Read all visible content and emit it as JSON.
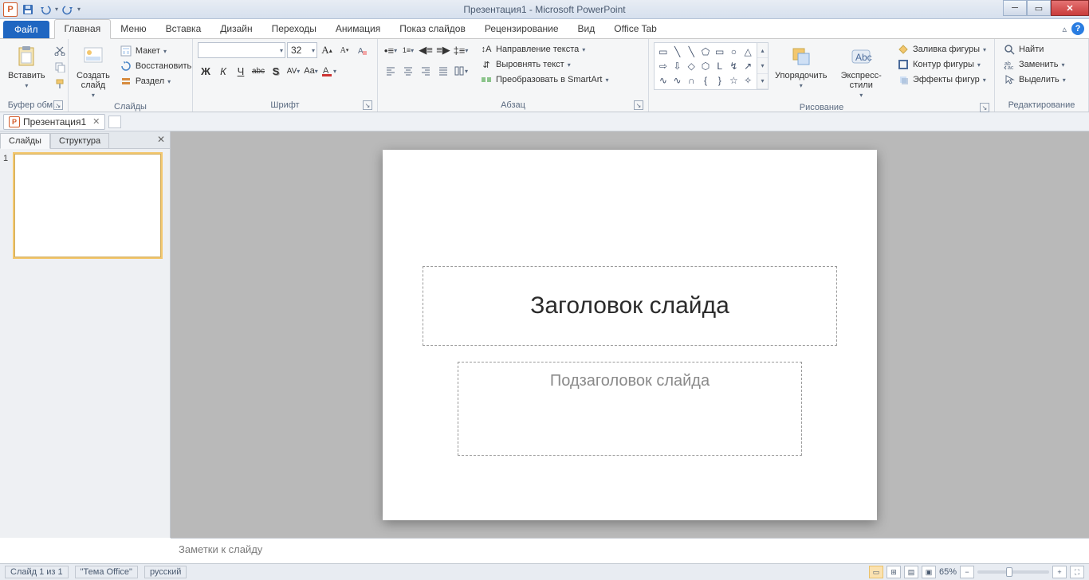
{
  "title": "Презентация1 - Microsoft PowerPoint",
  "qat": {
    "save": "save",
    "undo": "undo",
    "redo": "redo"
  },
  "tabs": {
    "file": "Файл",
    "items": [
      "Главная",
      "Меню",
      "Вставка",
      "Дизайн",
      "Переходы",
      "Анимация",
      "Показ слайдов",
      "Рецензирование",
      "Вид",
      "Office Tab"
    ],
    "active": "Главная"
  },
  "ribbon": {
    "clipboard": {
      "label": "Буфер обм...",
      "paste": "Вставить"
    },
    "slides": {
      "label": "Слайды",
      "new_slide": "Создать\nслайд",
      "layout": "Макет",
      "reset": "Восстановить",
      "section": "Раздел"
    },
    "font": {
      "label": "Шрифт",
      "size": "32",
      "bold": "Ж",
      "italic": "К",
      "underline": "Ч",
      "strike": "abc",
      "shadow": "S"
    },
    "paragraph": {
      "label": "Абзац",
      "text_dir": "Направление текста",
      "align_text": "Выровнять текст",
      "smartart": "Преобразовать в SmartArt"
    },
    "drawing": {
      "label": "Рисование",
      "arrange": "Упорядочить",
      "quick_styles": "Экспресс-стили",
      "fill": "Заливка фигуры",
      "outline": "Контур фигуры",
      "effects": "Эффекты фигур"
    },
    "editing": {
      "label": "Редактирование",
      "find": "Найти",
      "replace": "Заменить",
      "select": "Выделить"
    }
  },
  "doc_tab": {
    "name": "Презентация1"
  },
  "side": {
    "tab_slides": "Слайды",
    "tab_outline": "Структура",
    "thumb_num": "1"
  },
  "slide": {
    "title_ph": "Заголовок слайда",
    "subtitle_ph": "Подзаголовок слайда"
  },
  "notes": {
    "placeholder": "Заметки к слайду"
  },
  "status": {
    "slide": "Слайд 1 из 1",
    "theme": "\"Тема Office\"",
    "lang": "русский",
    "zoom": "65%"
  }
}
